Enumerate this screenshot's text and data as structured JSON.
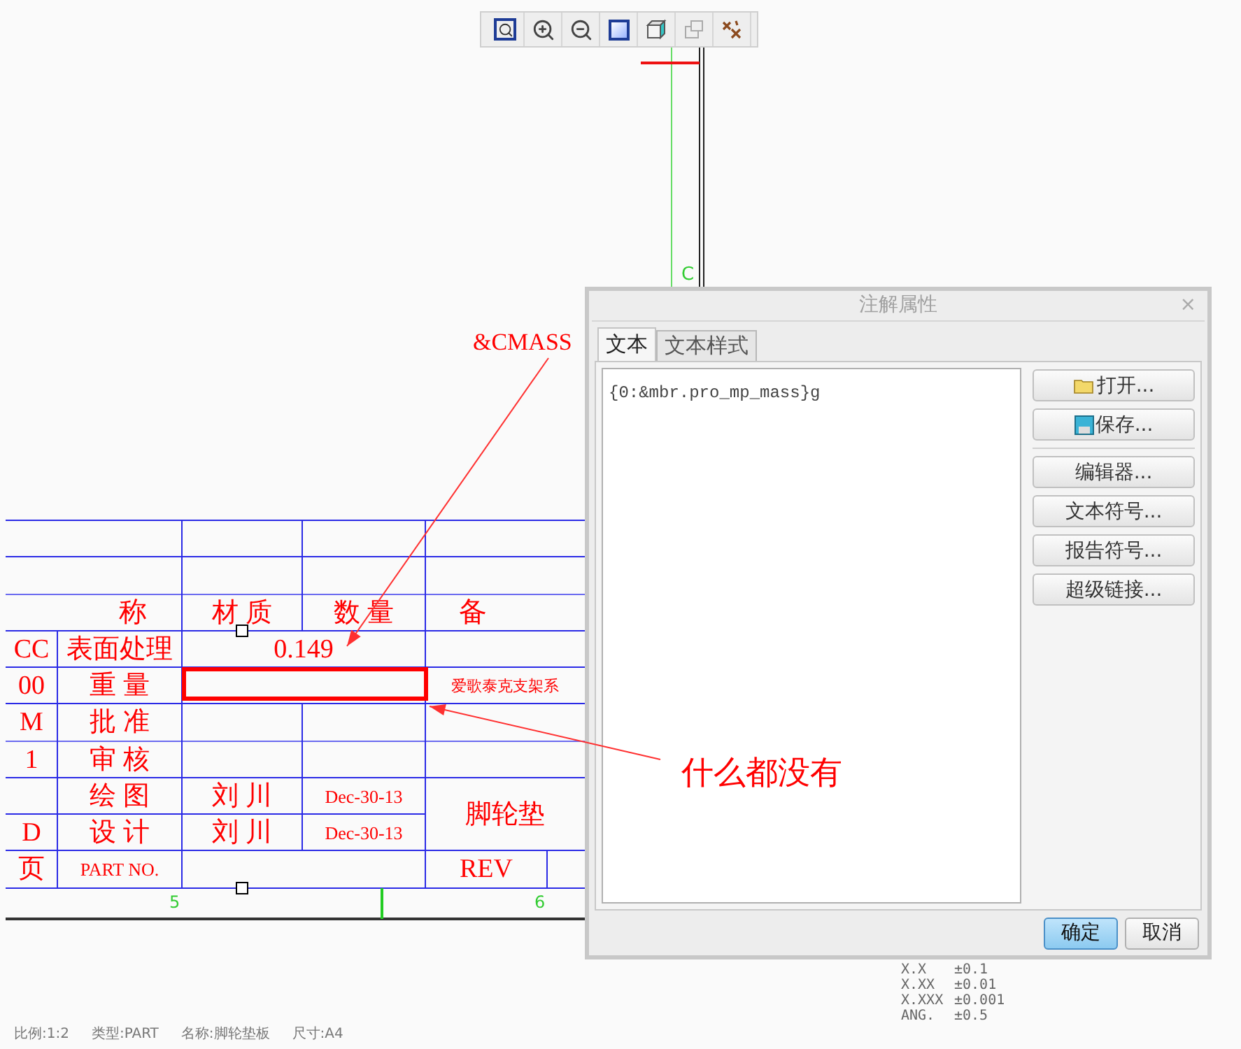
{
  "drawing": {
    "title_block": {
      "rows": [
        [
          {
            "text": ""
          },
          {
            "text": "称"
          },
          {
            "text": "材 质"
          },
          {
            "text": "数 量"
          },
          {
            "text": "备"
          }
        ],
        [
          {
            "text": "CC"
          },
          {
            "text": "表面处理"
          },
          {
            "text": "0.149"
          }
        ],
        [
          {
            "text": "00"
          },
          {
            "text": "重 量"
          },
          {
            "highlighted": true
          },
          {
            "text": "爱歌泰克支架系"
          }
        ],
        [
          {
            "text": "M"
          },
          {
            "text": "批 准"
          }
        ],
        [
          {
            "text": "1"
          },
          {
            "text": "审 核"
          }
        ],
        [
          {
            "text": ""
          },
          {
            "text": "绘 图"
          },
          {
            "text": "刘 川"
          },
          {
            "text": "Dec-30-13"
          },
          {
            "text": "脚轮垫"
          }
        ],
        [
          {
            "text": "D"
          },
          {
            "text": "设 计"
          },
          {
            "text": "刘 川"
          },
          {
            "text": "Dec-30-13"
          }
        ],
        [
          {
            "text": "页"
          },
          {
            "text": "PART NO."
          },
          {
            "text": ""
          },
          {
            "text": "REV"
          }
        ]
      ]
    },
    "zone_labels": [
      "5",
      "6"
    ],
    "axis_label": "C",
    "annotations": [
      {
        "text": "&CMASS"
      },
      {
        "text": "什么都没有"
      }
    ],
    "sheet_info": [
      "比例:1:2",
      "类型:PART",
      "名称:脚轮垫板",
      "尺寸:A4"
    ],
    "tolerances": [
      {
        "format": "X.X",
        "value": "±0.1"
      },
      {
        "format": "X.XX",
        "value": "±0.01"
      },
      {
        "format": "X.XXX",
        "value": "±0.001"
      },
      {
        "format": "ANG.",
        "value": "±0.5"
      }
    ]
  },
  "dialog": {
    "title": "注解属性",
    "close": "×",
    "tabs": [
      {
        "label": "文本",
        "selected": true
      },
      {
        "label": "文本样式",
        "selected": false
      }
    ],
    "text_value": "{0:&mbr.pro_mp_mass}g",
    "side_buttons": [
      "打开...",
      "保存...",
      "编辑器...",
      "文本符号...",
      "报告符号...",
      "超级链接..."
    ],
    "footer_buttons": [
      {
        "label": "确定",
        "default": true
      },
      {
        "label": "取消",
        "default": false
      }
    ]
  }
}
